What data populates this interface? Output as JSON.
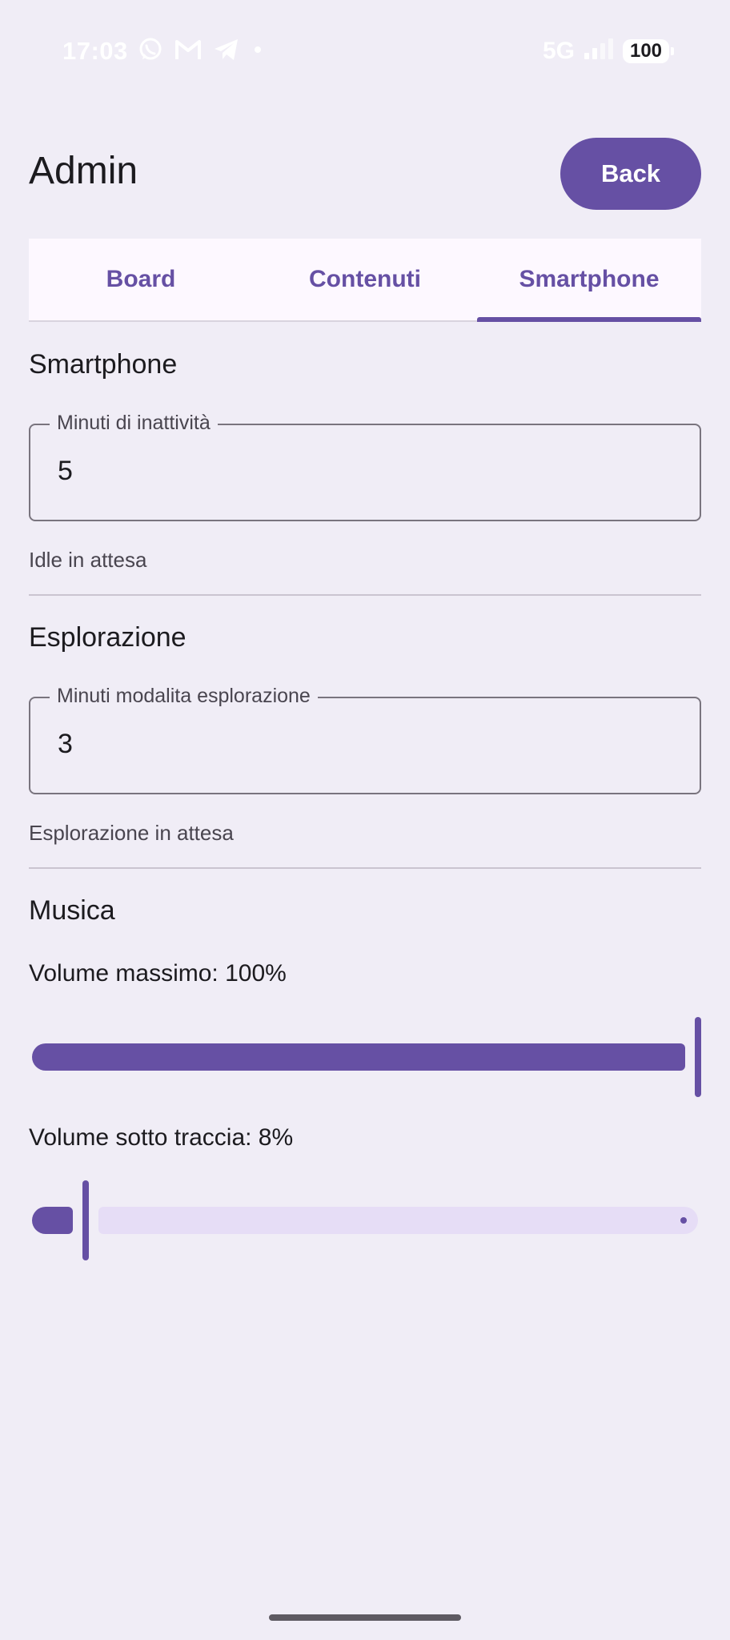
{
  "status_bar": {
    "time": "17:03",
    "network": "5G",
    "battery": "100",
    "icons": [
      "whatsapp-icon",
      "gmail-icon",
      "telegram-icon",
      "notification-dot-icon",
      "signal-icon"
    ]
  },
  "header": {
    "title": "Admin",
    "back_label": "Back"
  },
  "tabs": [
    {
      "label": "Board",
      "active": false
    },
    {
      "label": "Contenuti",
      "active": false
    },
    {
      "label": "Smartphone",
      "active": true
    }
  ],
  "smartphone": {
    "title": "Smartphone",
    "field_label": "Minuti di inattività",
    "field_value": "5",
    "helper": "Idle in attesa"
  },
  "exploration": {
    "title": "Esplorazione",
    "field_label": "Minuti modalita esplorazione",
    "field_value": "3",
    "helper": "Esplorazione in attesa"
  },
  "music": {
    "title": "Musica",
    "max_volume_label": "Volume massimo: 100%",
    "max_volume_value": 1.0,
    "background_volume_label": "Volume sotto traccia: 8%",
    "background_volume_value": 0.08
  },
  "colors": {
    "accent": "#6650a4",
    "background": "#f0edf6",
    "track_inactive": "#e6ddf6"
  }
}
